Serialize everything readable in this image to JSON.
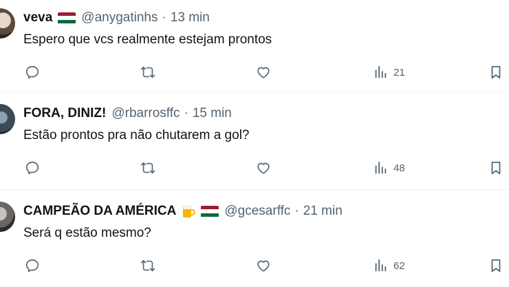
{
  "tweets": [
    {
      "name": "veva",
      "emoji": [
        "flag-red-white-green-icon"
      ],
      "handle": "@anygatinhs",
      "separator": "·",
      "time": "13 min",
      "text": "Espero que vcs realmente estejam prontos",
      "views": "21"
    },
    {
      "name": "FORA, DINIZ!",
      "emoji": [],
      "handle": "@rbarrosffc",
      "separator": "·",
      "time": "15 min",
      "text": "Estão prontos pra não chutarem a gol?",
      "views": "48"
    },
    {
      "name": "CAMPEÃO DA AMÉRICA",
      "emoji": [
        "beer-mug-icon",
        "flag-red-white-green-icon"
      ],
      "handle": "@gcesarffc",
      "separator": "·",
      "time": "21 min",
      "text": "Será q estão mesmo?",
      "views": "62"
    }
  ],
  "colors": {
    "text": "#0f1419",
    "secondary": "#536471",
    "flag_red": "#9e1b34",
    "flag_white": "#ffffff",
    "flag_green": "#0c6b3a",
    "divider": "#eff3f4"
  }
}
